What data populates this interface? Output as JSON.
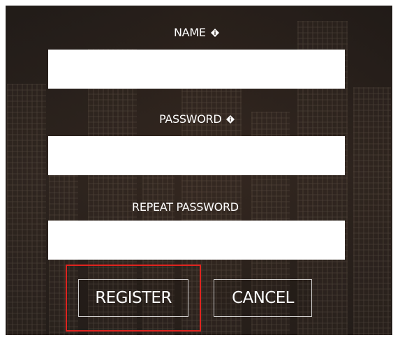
{
  "form": {
    "name_label": "NAME",
    "password_label": "PASSWORD",
    "repeat_password_label": "REPEAT PASSWORD",
    "name_value": "",
    "password_value": "",
    "repeat_password_value": "",
    "info_icon": "info-icon",
    "highlight_color": "#e0241f"
  },
  "actions": {
    "register_label": "REGISTER",
    "cancel_label": "CANCEL"
  }
}
